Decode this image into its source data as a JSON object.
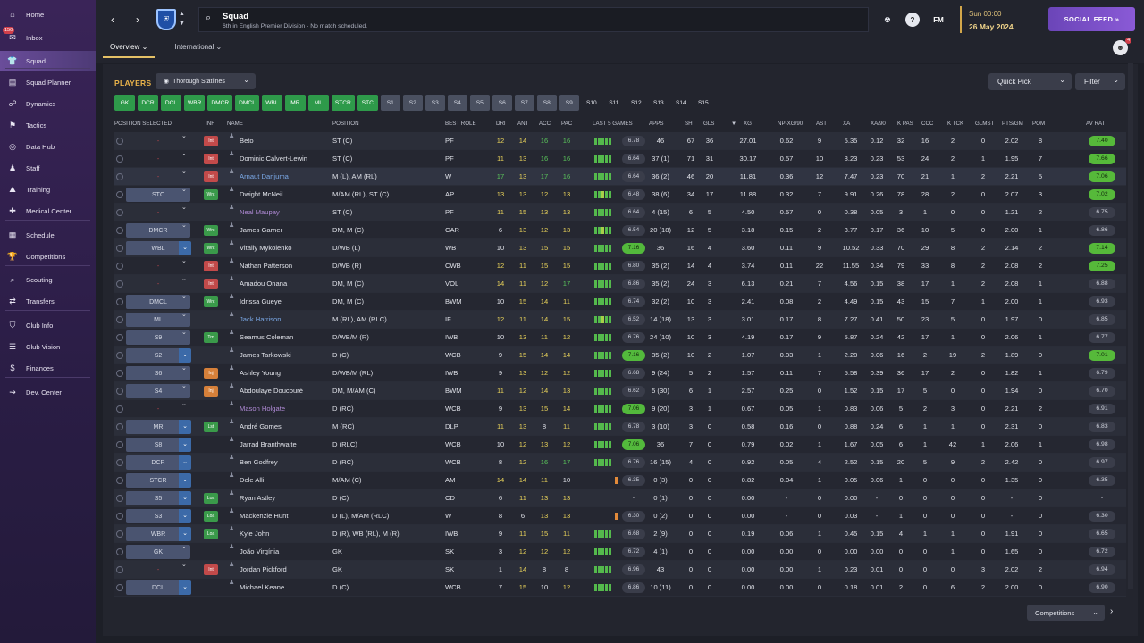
{
  "sidebar": {
    "items": [
      {
        "label": "Home",
        "icon": "home-icon"
      },
      {
        "label": "Inbox",
        "icon": "mail-icon"
      },
      {
        "label": "Squad",
        "icon": "shirt-icon"
      },
      {
        "label": "Squad Planner",
        "icon": "planner-icon"
      },
      {
        "label": "Dynamics",
        "icon": "dynamics-icon"
      },
      {
        "label": "Tactics",
        "icon": "tactics-icon"
      },
      {
        "label": "Data Hub",
        "icon": "data-hub-icon"
      },
      {
        "label": "Staff",
        "icon": "staff-icon"
      },
      {
        "label": "Training",
        "icon": "training-icon"
      },
      {
        "label": "Medical Center",
        "icon": "medical-icon"
      },
      {
        "label": "Schedule",
        "icon": "calendar-icon"
      },
      {
        "label": "Competitions",
        "icon": "trophy-icon"
      },
      {
        "label": "Scouting",
        "icon": "scouting-icon"
      },
      {
        "label": "Transfers",
        "icon": "transfers-icon"
      },
      {
        "label": "Club Info",
        "icon": "shield-icon"
      },
      {
        "label": "Club Vision",
        "icon": "vision-icon"
      },
      {
        "label": "Finances",
        "icon": "finances-icon"
      },
      {
        "label": "Dev. Center",
        "icon": "dev-center-icon"
      }
    ],
    "inbox_badge": "150",
    "active": "Squad"
  },
  "header": {
    "title": "Squad",
    "subtitle": "6th in English Premier Division - No match scheduled.",
    "time": "Sun 00:00",
    "date": "26 May 2024",
    "social": "SOCIAL FEED",
    "fm": "FM",
    "help": "?",
    "avatar_badge": "4"
  },
  "tabs": [
    {
      "label": "Overview"
    },
    {
      "label": "International"
    }
  ],
  "toolbar": {
    "players": "PLAYERS",
    "view": "Thorough Statlines",
    "quick_pick": "Quick Pick",
    "filter": "Filter"
  },
  "positions": [
    {
      "l": "GK",
      "k": "g"
    },
    {
      "l": "DCR",
      "k": "g"
    },
    {
      "l": "DCL",
      "k": "g"
    },
    {
      "l": "WBR",
      "k": "g"
    },
    {
      "l": "DMCR",
      "k": "g"
    },
    {
      "l": "DMCL",
      "k": "g"
    },
    {
      "l": "WBL",
      "k": "g"
    },
    {
      "l": "MR",
      "k": "g"
    },
    {
      "l": "ML",
      "k": "g"
    },
    {
      "l": "STCR",
      "k": "g"
    },
    {
      "l": "STC",
      "k": "g"
    },
    {
      "l": "S1",
      "k": "s"
    },
    {
      "l": "S2",
      "k": "s"
    },
    {
      "l": "S3",
      "k": "s"
    },
    {
      "l": "S4",
      "k": "s"
    },
    {
      "l": "S5",
      "k": "s"
    },
    {
      "l": "S6",
      "k": "s"
    },
    {
      "l": "S7",
      "k": "s"
    },
    {
      "l": "S8",
      "k": "s"
    },
    {
      "l": "S9",
      "k": "s"
    },
    {
      "l": "S10",
      "k": "o"
    },
    {
      "l": "S11",
      "k": "o"
    },
    {
      "l": "S12",
      "k": "o"
    },
    {
      "l": "S13",
      "k": "o"
    },
    {
      "l": "S14",
      "k": "o"
    },
    {
      "l": "S15",
      "k": "o"
    }
  ],
  "columns": [
    "POSITION SELECTED",
    "INF",
    "NAME",
    "POSITION",
    "BEST ROLE",
    "DRI",
    "ANT",
    "ACC",
    "PAC",
    "LAST 5 GAMES",
    "APPS",
    "SHT",
    "GLS",
    "▼",
    "XG",
    "NP-XG/90",
    "AST",
    "XA",
    "XA/90",
    "K PAS",
    "CCC",
    "K TCK",
    "GLMST",
    "PTS/GM",
    "POM",
    "AV RAT"
  ],
  "rows": [
    {
      "pos": "-",
      "inf": "Int",
      "infc": "red",
      "name": "Beto",
      "posn": "ST (C)",
      "role": "PF",
      "dri": "12",
      "ant": "14",
      "acc": "16",
      "pac": "16",
      "form": "6.78",
      "apps": "46",
      "sht": "67",
      "gls": "36",
      "xg": "27.01",
      "npxg": "0.62",
      "ast": "9",
      "xa": "5.35",
      "xa90": "0.12",
      "kpas": "32",
      "ccc": "16",
      "ktck": "2",
      "glmst": "0",
      "ptsgm": "2.02",
      "pom": "8",
      "avr": "7.40",
      "avrhi": true
    },
    {
      "pos": "-",
      "inf": "Int",
      "infc": "red",
      "name": "Dominic Calvert-Lewin",
      "posn": "ST (C)",
      "role": "PF",
      "dri": "11",
      "ant": "13",
      "acc": "16",
      "pac": "16",
      "form": "6.64",
      "apps": "37 (1)",
      "sht": "71",
      "gls": "31",
      "xg": "30.17",
      "npxg": "0.57",
      "ast": "10",
      "xa": "8.23",
      "xa90": "0.23",
      "kpas": "53",
      "ccc": "24",
      "ktck": "2",
      "glmst": "1",
      "ptsgm": "1.95",
      "pom": "7",
      "avr": "7.66",
      "avrhi": true
    },
    {
      "pos": "-",
      "inf": "Int",
      "infc": "red",
      "name": "Arnaut Danjuma",
      "namec": "blu",
      "posn": "M (L), AM (RL)",
      "role": "W",
      "dri": "17",
      "ant": "13",
      "acc": "17",
      "pac": "16",
      "form": "6.64",
      "apps": "36 (2)",
      "sht": "46",
      "gls": "20",
      "xg": "11.81",
      "npxg": "0.36",
      "ast": "12",
      "xa": "7.47",
      "xa90": "0.23",
      "kpas": "70",
      "ccc": "21",
      "ktck": "1",
      "glmst": "2",
      "ptsgm": "2.21",
      "pom": "5",
      "avr": "7.06",
      "avrhi": true,
      "sel": true
    },
    {
      "pos": "STC",
      "inf": "Wnt",
      "infc": "grn",
      "name": "Dwight McNeil",
      "posn": "M/AM (RL), ST (C)",
      "role": "AP",
      "dri": "13",
      "ant": "13",
      "acc": "12",
      "pac": "13",
      "form": "6.48",
      "apps": "38 (6)",
      "sht": "34",
      "gls": "17",
      "xg": "11.88",
      "npxg": "0.32",
      "ast": "7",
      "xa": "9.91",
      "xa90": "0.26",
      "kpas": "78",
      "ccc": "28",
      "ktck": "2",
      "glmst": "0",
      "ptsgm": "2.07",
      "pom": "3",
      "avr": "7.02",
      "avrhi": true
    },
    {
      "pos": "-",
      "inf": "",
      "infc": "",
      "name": "Neal Maupay",
      "namec": "pur",
      "posn": "ST (C)",
      "role": "PF",
      "dri": "11",
      "ant": "15",
      "acc": "13",
      "pac": "13",
      "form": "6.64",
      "apps": "4 (15)",
      "sht": "6",
      "gls": "5",
      "xg": "4.50",
      "npxg": "0.57",
      "ast": "0",
      "xa": "0.38",
      "xa90": "0.05",
      "kpas": "3",
      "ccc": "1",
      "ktck": "0",
      "glmst": "0",
      "ptsgm": "1.21",
      "pom": "2",
      "avr": "6.75",
      "avrhi": false
    },
    {
      "pos": "DMCR",
      "inf": "Wnt",
      "infc": "grn",
      "name": "James Garner",
      "posn": "DM, M (C)",
      "role": "CAR",
      "dri": "6",
      "ant": "13",
      "acc": "12",
      "pac": "13",
      "form": "6.54",
      "apps": "20 (18)",
      "sht": "12",
      "gls": "5",
      "xg": "3.18",
      "npxg": "0.15",
      "ast": "2",
      "xa": "3.77",
      "xa90": "0.17",
      "kpas": "36",
      "ccc": "10",
      "ktck": "5",
      "glmst": "0",
      "ptsgm": "2.00",
      "pom": "1",
      "avr": "6.86",
      "avrhi": false
    },
    {
      "pos": "WBL",
      "inf": "Wnt",
      "infc": "grn",
      "name": "Vitaliy Mykolenko",
      "posn": "D/WB (L)",
      "role": "WB",
      "dri": "10",
      "ant": "13",
      "acc": "15",
      "pac": "15",
      "form": "7.16",
      "formhi": true,
      "apps": "36",
      "sht": "16",
      "gls": "4",
      "xg": "3.60",
      "npxg": "0.11",
      "ast": "9",
      "xa": "10.52",
      "xa90": "0.33",
      "kpas": "70",
      "ccc": "29",
      "ktck": "8",
      "glmst": "2",
      "ptsgm": "2.14",
      "pom": "2",
      "avr": "7.14",
      "avrhi": true
    },
    {
      "pos": "-",
      "inf": "Int",
      "infc": "red",
      "name": "Nathan Patterson",
      "posn": "D/WB (R)",
      "role": "CWB",
      "dri": "12",
      "ant": "11",
      "acc": "15",
      "pac": "15",
      "form": "6.80",
      "apps": "35 (2)",
      "sht": "14",
      "gls": "4",
      "xg": "3.74",
      "npxg": "0.11",
      "ast": "22",
      "xa": "11.55",
      "xa90": "0.34",
      "kpas": "79",
      "ccc": "33",
      "ktck": "8",
      "glmst": "2",
      "ptsgm": "2.08",
      "pom": "2",
      "avr": "7.25",
      "avrhi": true
    },
    {
      "pos": "-",
      "inf": "Int",
      "infc": "red",
      "name": "Amadou Onana",
      "posn": "DM, M (C)",
      "role": "VOL",
      "dri": "14",
      "ant": "11",
      "acc": "12",
      "pac": "17",
      "form": "6.86",
      "apps": "35 (2)",
      "sht": "24",
      "gls": "3",
      "xg": "6.13",
      "npxg": "0.21",
      "ast": "7",
      "xa": "4.56",
      "xa90": "0.15",
      "kpas": "38",
      "ccc": "17",
      "ktck": "1",
      "glmst": "2",
      "ptsgm": "2.08",
      "pom": "1",
      "avr": "6.88",
      "avrhi": false
    },
    {
      "pos": "DMCL",
      "inf": "Wnt",
      "infc": "grn",
      "name": "Idrissa Gueye",
      "posn": "DM, M (C)",
      "role": "BWM",
      "dri": "10",
      "ant": "15",
      "acc": "14",
      "pac": "11",
      "form": "6.74",
      "apps": "32 (2)",
      "sht": "10",
      "gls": "3",
      "xg": "2.41",
      "npxg": "0.08",
      "ast": "2",
      "xa": "4.49",
      "xa90": "0.15",
      "kpas": "43",
      "ccc": "15",
      "ktck": "7",
      "glmst": "1",
      "ptsgm": "2.00",
      "pom": "1",
      "avr": "6.93",
      "avrhi": false
    },
    {
      "pos": "ML",
      "inf": "",
      "infc": "",
      "name": "Jack Harrison",
      "namec": "blu",
      "posn": "M (RL), AM (RLC)",
      "role": "IF",
      "dri": "12",
      "ant": "11",
      "acc": "14",
      "pac": "15",
      "form": "6.52",
      "apps": "14 (18)",
      "sht": "13",
      "gls": "3",
      "xg": "3.01",
      "npxg": "0.17",
      "ast": "8",
      "xa": "7.27",
      "xa90": "0.41",
      "kpas": "50",
      "ccc": "23",
      "ktck": "5",
      "glmst": "0",
      "ptsgm": "1.97",
      "pom": "0",
      "avr": "6.85",
      "avrhi": false
    },
    {
      "pos": "S9",
      "inf": "Trn",
      "infc": "grn",
      "name": "Seamus Coleman",
      "posn": "D/WB/M (R)",
      "role": "IWB",
      "dri": "10",
      "ant": "13",
      "acc": "11",
      "pac": "12",
      "form": "6.76",
      "apps": "24 (10)",
      "sht": "10",
      "gls": "3",
      "xg": "4.19",
      "npxg": "0.17",
      "ast": "9",
      "xa": "5.87",
      "xa90": "0.24",
      "kpas": "42",
      "ccc": "17",
      "ktck": "1",
      "glmst": "0",
      "ptsgm": "2.06",
      "pom": "1",
      "avr": "6.77",
      "avrhi": false
    },
    {
      "pos": "S2",
      "inf": "",
      "infc": "",
      "name": "James Tarkowski",
      "posn": "D (C)",
      "role": "WCB",
      "dri": "9",
      "ant": "15",
      "acc": "14",
      "pac": "14",
      "form": "7.16",
      "formhi": true,
      "apps": "35 (2)",
      "sht": "10",
      "gls": "2",
      "xg": "1.07",
      "npxg": "0.03",
      "ast": "1",
      "xa": "2.20",
      "xa90": "0.06",
      "kpas": "16",
      "ccc": "2",
      "ktck": "19",
      "glmst": "2",
      "ptsgm": "1.89",
      "pom": "0",
      "avr": "7.01",
      "avrhi": true
    },
    {
      "pos": "S6",
      "inf": "Inj",
      "infc": "org",
      "name": "Ashley Young",
      "posn": "D/WB/M (RL)",
      "role": "IWB",
      "dri": "9",
      "ant": "13",
      "acc": "12",
      "pac": "12",
      "form": "6.68",
      "apps": "9 (24)",
      "sht": "5",
      "gls": "2",
      "xg": "1.57",
      "npxg": "0.11",
      "ast": "7",
      "xa": "5.58",
      "xa90": "0.39",
      "kpas": "36",
      "ccc": "17",
      "ktck": "2",
      "glmst": "0",
      "ptsgm": "1.82",
      "pom": "1",
      "avr": "6.79",
      "avrhi": false
    },
    {
      "pos": "S4",
      "inf": "Inj",
      "infc": "org",
      "name": "Abdoulaye Doucouré",
      "posn": "DM, M/AM (C)",
      "role": "BWM",
      "dri": "11",
      "ant": "12",
      "acc": "14",
      "pac": "13",
      "form": "6.62",
      "apps": "5 (30)",
      "sht": "6",
      "gls": "1",
      "xg": "2.57",
      "npxg": "0.25",
      "ast": "0",
      "xa": "1.52",
      "xa90": "0.15",
      "kpas": "17",
      "ccc": "5",
      "ktck": "0",
      "glmst": "0",
      "ptsgm": "1.94",
      "pom": "0",
      "avr": "6.70",
      "avrhi": false
    },
    {
      "pos": "-",
      "inf": "",
      "infc": "",
      "name": "Mason Holgate",
      "namec": "pur",
      "posn": "D (RC)",
      "role": "WCB",
      "dri": "9",
      "ant": "13",
      "acc": "15",
      "pac": "14",
      "form": "7.06",
      "formhi": true,
      "apps": "9 (20)",
      "sht": "3",
      "gls": "1",
      "xg": "0.67",
      "npxg": "0.05",
      "ast": "1",
      "xa": "0.83",
      "xa90": "0.06",
      "kpas": "5",
      "ccc": "2",
      "ktck": "3",
      "glmst": "0",
      "ptsgm": "2.21",
      "pom": "2",
      "avr": "6.91",
      "avrhi": false
    },
    {
      "pos": "MR",
      "inf": "Lst",
      "infc": "grn",
      "name": "André Gomes",
      "posn": "M (RC)",
      "role": "DLP",
      "dri": "11",
      "ant": "13",
      "acc": "8",
      "pac": "11",
      "form": "6.78",
      "apps": "3 (10)",
      "sht": "3",
      "gls": "0",
      "xg": "0.58",
      "npxg": "0.16",
      "ast": "0",
      "xa": "0.88",
      "xa90": "0.24",
      "kpas": "6",
      "ccc": "1",
      "ktck": "1",
      "glmst": "0",
      "ptsgm": "2.31",
      "pom": "0",
      "avr": "6.83",
      "avrhi": false
    },
    {
      "pos": "S8",
      "inf": "",
      "infc": "",
      "name": "Jarrad Branthwaite",
      "posn": "D (RLC)",
      "role": "WCB",
      "dri": "10",
      "ant": "12",
      "acc": "13",
      "pac": "12",
      "form": "7.06",
      "formhi": true,
      "apps": "36",
      "sht": "7",
      "gls": "0",
      "xg": "0.79",
      "npxg": "0.02",
      "ast": "1",
      "xa": "1.67",
      "xa90": "0.05",
      "kpas": "6",
      "ccc": "1",
      "ktck": "42",
      "glmst": "1",
      "ptsgm": "2.06",
      "pom": "1",
      "avr": "6.98",
      "avrhi": false
    },
    {
      "pos": "DCR",
      "inf": "",
      "infc": "",
      "name": "Ben Godfrey",
      "posn": "D (RC)",
      "role": "WCB",
      "dri": "8",
      "ant": "12",
      "acc": "16",
      "pac": "17",
      "form": "6.76",
      "apps": "16 (15)",
      "sht": "4",
      "gls": "0",
      "xg": "0.92",
      "npxg": "0.05",
      "ast": "4",
      "xa": "2.52",
      "xa90": "0.15",
      "kpas": "20",
      "ccc": "5",
      "ktck": "9",
      "glmst": "2",
      "ptsgm": "2.42",
      "pom": "0",
      "avr": "6.97",
      "avrhi": false
    },
    {
      "pos": "STCR",
      "inf": "",
      "infc": "",
      "name": "Dele Alli",
      "posn": "M/AM (C)",
      "role": "AM",
      "dri": "14",
      "ant": "14",
      "acc": "11",
      "pac": "10",
      "form": "6.35",
      "apps": "0 (3)",
      "sht": "0",
      "gls": "0",
      "xg": "0.82",
      "npxg": "0.04",
      "ast": "1",
      "xa": "0.05",
      "xa90": "0.06",
      "kpas": "1",
      "ccc": "0",
      "ktck": "0",
      "glmst": "0",
      "ptsgm": "1.35",
      "pom": "0",
      "avr": "6.35",
      "avrhi": false
    },
    {
      "pos": "S5",
      "inf": "Loa",
      "infc": "grn",
      "name": "Ryan Astley",
      "posn": "D (C)",
      "role": "CD",
      "dri": "6",
      "ant": "11",
      "acc": "13",
      "pac": "13",
      "form": "-",
      "apps": "0 (1)",
      "sht": "0",
      "gls": "0",
      "xg": "0.00",
      "npxg": "-",
      "ast": "0",
      "xa": "0.00",
      "xa90": "-",
      "kpas": "0",
      "ccc": "0",
      "ktck": "0",
      "glmst": "0",
      "ptsgm": "-",
      "pom": "0",
      "avr": "-",
      "avrhi": false
    },
    {
      "pos": "S3",
      "inf": "Loa",
      "infc": "grn",
      "name": "Mackenzie Hunt",
      "posn": "D (L), M/AM (RLC)",
      "role": "W",
      "dri": "8",
      "ant": "6",
      "acc": "13",
      "pac": "13",
      "form": "6.30",
      "apps": "0 (2)",
      "sht": "0",
      "gls": "0",
      "xg": "0.00",
      "npxg": "-",
      "ast": "0",
      "xa": "0.03",
      "xa90": "-",
      "kpas": "1",
      "ccc": "0",
      "ktck": "0",
      "glmst": "0",
      "ptsgm": "-",
      "pom": "0",
      "avr": "6.30",
      "avrhi": false
    },
    {
      "pos": "WBR",
      "inf": "Loa",
      "infc": "grn",
      "name": "Kyle John",
      "posn": "D (R), WB (RL), M (R)",
      "role": "IWB",
      "dri": "9",
      "ant": "11",
      "acc": "15",
      "pac": "11",
      "form": "6.68",
      "apps": "2 (9)",
      "sht": "0",
      "gls": "0",
      "xg": "0.19",
      "npxg": "0.06",
      "ast": "1",
      "xa": "0.45",
      "xa90": "0.15",
      "kpas": "4",
      "ccc": "1",
      "ktck": "1",
      "glmst": "0",
      "ptsgm": "1.91",
      "pom": "0",
      "avr": "6.65",
      "avrhi": false
    },
    {
      "pos": "GK",
      "inf": "",
      "infc": "",
      "name": "João Virgínia",
      "posn": "GK",
      "role": "SK",
      "dri": "3",
      "ant": "12",
      "acc": "12",
      "pac": "12",
      "form": "6.72",
      "apps": "4 (1)",
      "sht": "0",
      "gls": "0",
      "xg": "0.00",
      "npxg": "0.00",
      "ast": "0",
      "xa": "0.00",
      "xa90": "0.00",
      "kpas": "0",
      "ccc": "0",
      "ktck": "1",
      "glmst": "0",
      "ptsgm": "1.65",
      "pom": "0",
      "avr": "6.72",
      "avrhi": false
    },
    {
      "pos": "-",
      "inf": "Int",
      "infc": "red",
      "name": "Jordan Pickford",
      "posn": "GK",
      "role": "SK",
      "dri": "1",
      "ant": "14",
      "acc": "8",
      "pac": "8",
      "form": "6.96",
      "apps": "43",
      "sht": "0",
      "gls": "0",
      "xg": "0.00",
      "npxg": "0.00",
      "ast": "1",
      "xa": "0.23",
      "xa90": "0.01",
      "kpas": "0",
      "ccc": "0",
      "ktck": "0",
      "glmst": "3",
      "ptsgm": "2.02",
      "pom": "2",
      "avr": "6.94",
      "avrhi": false
    },
    {
      "pos": "DCL",
      "inf": "",
      "infc": "",
      "name": "Michael Keane",
      "posn": "D (C)",
      "role": "WCB",
      "dri": "7",
      "ant": "15",
      "acc": "10",
      "pac": "12",
      "form": "6.86",
      "apps": "10 (11)",
      "sht": "0",
      "gls": "0",
      "xg": "0.00",
      "npxg": "0.00",
      "ast": "0",
      "xa": "0.18",
      "xa90": "0.01",
      "kpas": "2",
      "ccc": "0",
      "ktck": "6",
      "glmst": "2",
      "ptsgm": "2.00",
      "pom": "0",
      "avr": "6.90",
      "avrhi": false
    }
  ],
  "footer": {
    "competitions": "Competitions"
  },
  "colors": {
    "accent": "#e8b24a",
    "green": "#2e9a4a",
    "purple": "#6b45b8"
  }
}
